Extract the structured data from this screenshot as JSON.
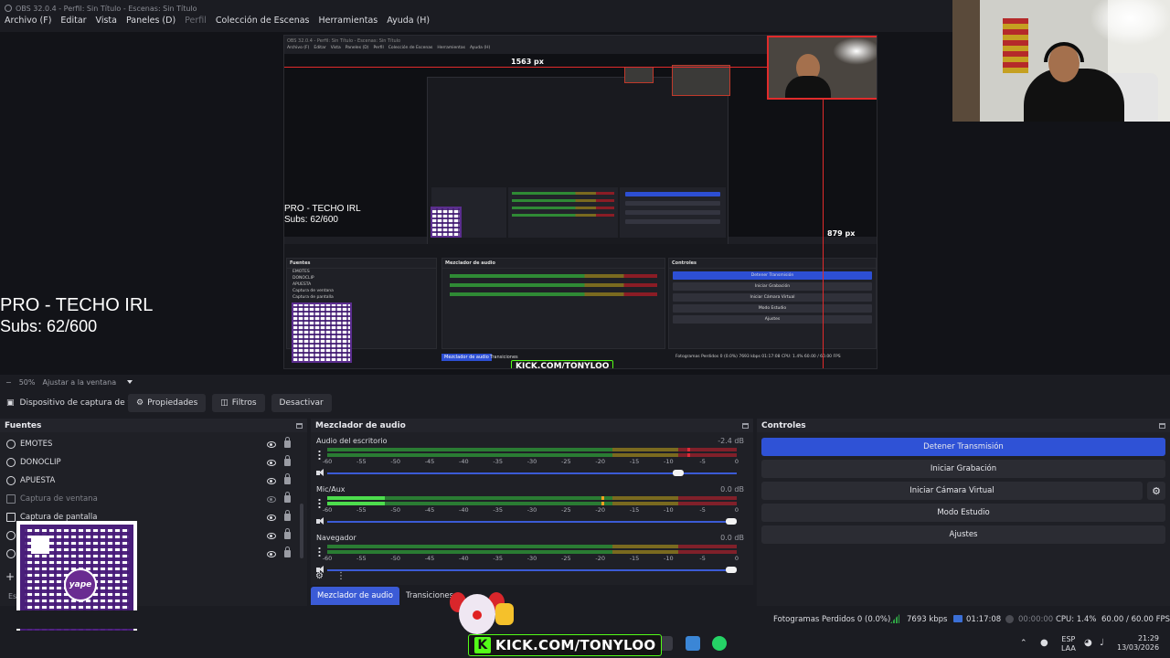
{
  "window": {
    "title": "OBS 32.0.4 - Perfil: Sin Título - Escenas: Sin Título"
  },
  "menu": [
    {
      "label": "Archivo (F)",
      "disabled": false
    },
    {
      "label": "Editar",
      "disabled": false
    },
    {
      "label": "Vista",
      "disabled": false
    },
    {
      "label": "Paneles (D)",
      "disabled": false
    },
    {
      "label": "Perfil",
      "disabled": true
    },
    {
      "label": "Colección de Escenas",
      "disabled": false
    },
    {
      "label": "Herramientas",
      "disabled": false
    },
    {
      "label": "Ayuda (H)",
      "disabled": false
    }
  ],
  "preview": {
    "overlay_title": "PRO - TECHO IRL",
    "overlay_subs": "Subs: 62/600",
    "width_label": "1563 px",
    "height_label": "879 px",
    "nested_title": "OBS 32.0.4 - Perfil: Sin Título - Escenas: Sin Título",
    "nested_menu": [
      "Archivo (F)",
      "Editar",
      "Vista",
      "Paneles (D)",
      "Perfil",
      "Colección de Escenas",
      "Herramientas",
      "Ayuda (H)"
    ],
    "nested_sources_head": "Fuentes",
    "nested_sources": [
      "EMOTES",
      "DONOCLIP",
      "APUESTA",
      "Captura de ventana",
      "Captura de pantalla"
    ],
    "nested_mixer_head": "Mezclador de audio",
    "nested_controls_head": "Controles",
    "nested_controls": [
      "Detener Transmisión",
      "Iniciar Grabación",
      "Iniciar Cámara Virtual",
      "Modo Estudio",
      "Ajustes"
    ],
    "nested_tab_mixer": "Mezclador de audio",
    "nested_tab_trans": "Transiciones",
    "nested_status": "Fotogramas Perdidos 0 (0.0%)   7693 kbps   01:17:08   CPU: 1.4%   60.00 / 60.00 FPS",
    "kick_text": "KICK.COM/TONYLOO"
  },
  "zoom": {
    "minus": "−",
    "value": "50%",
    "fit_label": "Ajustar a la ventana"
  },
  "toolbar": {
    "source_name": "Dispositivo de captura de v",
    "properties": "Propiedades",
    "filters": "Filtros",
    "deactivate": "Desactivar"
  },
  "sources": {
    "title": "Fuentes",
    "items": [
      {
        "name": "EMOTES",
        "visible": true,
        "type": "browser"
      },
      {
        "name": "DONOCLIP",
        "visible": true,
        "type": "browser"
      },
      {
        "name": "APUESTA",
        "visible": true,
        "type": "browser"
      },
      {
        "name": "Captura de ventana",
        "visible": false,
        "type": "window"
      },
      {
        "name": "Captura de pantalla",
        "visible": true,
        "type": "screen"
      },
      {
        "name": "",
        "visible": true,
        "type": "browser"
      },
      {
        "name": "",
        "visible": true,
        "type": "browser"
      }
    ],
    "add": "+",
    "bottom_label": "Es"
  },
  "mixer": {
    "title": "Mezclador de audio",
    "ticks": [
      "-60",
      "-55",
      "-50",
      "-45",
      "-40",
      "-35",
      "-30",
      "-25",
      "-20",
      "-15",
      "-10",
      "-5",
      "0"
    ],
    "channels": [
      {
        "name": "Audio del escritorio",
        "db": "-2.4 dB",
        "level": 0,
        "peak": 0.88,
        "volume": 0.87
      },
      {
        "name": "Mic/Aux",
        "db": "0.0 dB",
        "level": 0.14,
        "peak": 0.67,
        "volume": 1.0
      },
      {
        "name": "Navegador",
        "db": "0.0 dB",
        "level": 0,
        "peak": 0,
        "volume": 1.0
      }
    ],
    "footer_gear": "⚙",
    "footer_menu": "⋮"
  },
  "dock_tabs": [
    {
      "label": "Mezclador de audio",
      "active": true
    },
    {
      "label": "Transiciones",
      "active": false
    }
  ],
  "controls": {
    "title": "Controles",
    "buttons": [
      {
        "label": "Detener Transmisión",
        "primary": true
      },
      {
        "label": "Iniciar Grabación",
        "primary": false
      },
      {
        "label": "Iniciar Cámara Virtual",
        "primary": false
      },
      {
        "label": "Modo Estudio",
        "primary": false
      },
      {
        "label": "Ajustes",
        "primary": false
      }
    ]
  },
  "status": {
    "dropped_frames": "Fotogramas Perdidos 0 (0.0%)",
    "bitrate": "7693 kbps",
    "stream_time": "01:17:08",
    "rec_time": "00:00:00",
    "cpu": "CPU: 1.4%",
    "fps": "60.00 / 60.00 FPS"
  },
  "overlay": {
    "kick_text": "KICK.COM/TONYLOO",
    "kick_letter": "K",
    "qr_badge": "yape"
  },
  "taskbar": {
    "lang_top": "ESP",
    "lang_bottom": "LAA",
    "time": "21:29",
    "date": "13/03/2026"
  },
  "colors": {
    "accent": "#2f52d6",
    "background": "#1f2026",
    "meter_green": "#2a7c33",
    "meter_yellow": "#7a6a1f",
    "meter_red": "#80202a",
    "kick_green": "#53fc18"
  }
}
